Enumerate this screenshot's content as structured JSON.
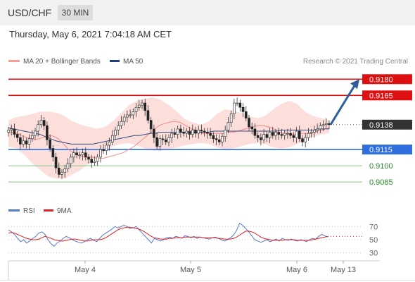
{
  "header": {
    "symbol": "USD/CHF",
    "timeframe": "30 MIN"
  },
  "datetime": "Thursday, May 6, 2021 7:04:18 AM CET",
  "legend": {
    "items": [
      {
        "label": "MA 20 + Bollinger Bands",
        "color": "#f4a09a"
      },
      {
        "label": "MA 50",
        "color": "#1f3f7a"
      }
    ],
    "credit": "Research © 2021 Trading Central"
  },
  "colors": {
    "resistance": "#dd1111",
    "current": "#333333",
    "pivot": "#2f6fdd",
    "support": "#8ac48a",
    "support_text": "#2a8a2a",
    "arrow": "#2f5f9a",
    "bollinger_fill": "#fbd8d5",
    "ma20": "#f08a82",
    "ma50": "#2d4a85",
    "rsi": "#5577cc",
    "rsi_ma": "#dd2222"
  },
  "chart_data": [
    {
      "type": "candlestick",
      "title": "USD/CHF",
      "x_tick_labels": [
        "May 4",
        "May 5",
        "May 6",
        "May 13"
      ],
      "ylim": [
        0.9076,
        0.9188
      ],
      "levels": [
        {
          "value": 0.918,
          "label": "0.9180",
          "kind": "resistance"
        },
        {
          "value": 0.9165,
          "label": "0.9165",
          "kind": "resistance"
        },
        {
          "value": 0.9138,
          "label": "0.9138",
          "kind": "current"
        },
        {
          "value": 0.9115,
          "label": "0.9115",
          "kind": "pivot"
        },
        {
          "value": 0.91,
          "label": "0.9100",
          "kind": "support"
        },
        {
          "value": 0.9085,
          "label": "0.9085",
          "kind": "support"
        }
      ],
      "forecast_arrow": {
        "from": 0.9138,
        "to": 0.918
      },
      "series_close": [
        0.9133,
        0.9134,
        0.9129,
        0.9126,
        0.912,
        0.9123,
        0.912,
        0.9125,
        0.9128,
        0.9132,
        0.9138,
        0.9142,
        0.9137,
        0.9124,
        0.9116,
        0.9108,
        0.9098,
        0.9092,
        0.9094,
        0.9097,
        0.9102,
        0.9108,
        0.9112,
        0.911,
        0.911,
        0.9112,
        0.9108,
        0.9106,
        0.9103,
        0.9104,
        0.9108,
        0.9115,
        0.9114,
        0.9119,
        0.9122,
        0.9128,
        0.9133,
        0.9137,
        0.9141,
        0.9145,
        0.9147,
        0.9147,
        0.915,
        0.9154,
        0.9156,
        0.9158,
        0.9151,
        0.9142,
        0.9134,
        0.9126,
        0.9118,
        0.9125,
        0.9124,
        0.9122,
        0.9126,
        0.913,
        0.9129,
        0.9134,
        0.9131,
        0.913,
        0.9132,
        0.9129,
        0.9133,
        0.913,
        0.9133,
        0.9132,
        0.9131,
        0.913,
        0.9128,
        0.9125,
        0.9124,
        0.9122,
        0.9127,
        0.9133,
        0.914,
        0.9148,
        0.9158,
        0.9158,
        0.9154,
        0.915,
        0.9144,
        0.9136,
        0.9134,
        0.9128,
        0.9126,
        0.9124,
        0.9129,
        0.9126,
        0.9131,
        0.9128,
        0.9131,
        0.9129,
        0.9128,
        0.913,
        0.913,
        0.9128,
        0.9126,
        0.9132,
        0.9125,
        0.9122,
        0.9126,
        0.913,
        0.9131,
        0.9133,
        0.9134,
        0.9137,
        0.9138,
        0.9139,
        0.9138
      ],
      "ma20": [
        0.913,
        0.9131,
        0.913,
        0.9129,
        0.9127,
        0.9126,
        0.9125,
        0.9124,
        0.9125,
        0.9126,
        0.9127,
        0.9128,
        0.9127,
        0.9125,
        0.9122,
        0.9118,
        0.9114,
        0.9112,
        0.911,
        0.9109,
        0.9108,
        0.9108,
        0.9108,
        0.9107,
        0.9107,
        0.9107,
        0.9108,
        0.9109,
        0.911,
        0.9111,
        0.9112,
        0.9114,
        0.9116,
        0.9118,
        0.9121,
        0.9124,
        0.9127,
        0.913,
        0.9133,
        0.9136,
        0.9138,
        0.9139,
        0.914,
        0.9141,
        0.9141,
        0.914,
        0.9138,
        0.9136,
        0.9134,
        0.9133,
        0.9131,
        0.913,
        0.913,
        0.913,
        0.913,
        0.913,
        0.913,
        0.913,
        0.9131,
        0.9131,
        0.9132,
        0.9133,
        0.9134,
        0.9135,
        0.9136,
        0.9137,
        0.9137,
        0.9137,
        0.9136,
        0.9135,
        0.9133,
        0.9131,
        0.913,
        0.9129,
        0.9129,
        0.9129,
        0.913,
        0.913,
        0.913,
        0.913,
        0.9131,
        0.9132,
        0.9133,
        0.9134,
        0.9135
      ],
      "ma50": [
        0.9135,
        0.9134,
        0.9133,
        0.9132,
        0.9131,
        0.913,
        0.9129,
        0.9127,
        0.9125,
        0.9123,
        0.9122,
        0.9121,
        0.912,
        0.912,
        0.912,
        0.912,
        0.912,
        0.9121,
        0.9122,
        0.9123,
        0.9124,
        0.9125,
        0.9126,
        0.9127,
        0.9128,
        0.9128,
        0.9129,
        0.913,
        0.913,
        0.9131,
        0.9131,
        0.9131,
        0.9131,
        0.9131,
        0.9131,
        0.9131,
        0.9131,
        0.9131,
        0.9131,
        0.9132,
        0.9132,
        0.9132,
        0.9132,
        0.9132,
        0.9132,
        0.9132,
        0.9132,
        0.9132,
        0.9132,
        0.9132,
        0.9132,
        0.9132,
        0.9133,
        0.9133,
        0.9133,
        0.9133,
        0.9133,
        0.9133,
        0.9133,
        0.9134,
        0.9134,
        0.9134
      ],
      "bollinger_upper": [
        0.9142,
        0.9145,
        0.9146,
        0.9148,
        0.915,
        0.915,
        0.9149,
        0.9146,
        0.9141,
        0.9138,
        0.9136,
        0.9134,
        0.9136,
        0.9141,
        0.9148,
        0.9156,
        0.916,
        0.9162,
        0.9163,
        0.9161,
        0.9156,
        0.915,
        0.9143,
        0.914,
        0.9138,
        0.9141,
        0.9148,
        0.9152,
        0.9151,
        0.9149,
        0.9146,
        0.9144,
        0.9146,
        0.9152,
        0.9157,
        0.916,
        0.9157,
        0.915,
        0.9146,
        0.9144,
        0.9142
      ],
      "bollinger_lower": [
        0.9118,
        0.9116,
        0.911,
        0.9102,
        0.9096,
        0.909,
        0.9088,
        0.9088,
        0.9092,
        0.9096,
        0.9102,
        0.9108,
        0.9114,
        0.9118,
        0.912,
        0.9121,
        0.9119,
        0.9116,
        0.9114,
        0.9114,
        0.9115,
        0.9117,
        0.9119,
        0.912,
        0.9121,
        0.912,
        0.9117,
        0.9115,
        0.9116,
        0.9118,
        0.912,
        0.9121,
        0.912,
        0.9117,
        0.9116,
        0.9117,
        0.912,
        0.9124,
        0.9127,
        0.9129,
        0.913
      ]
    },
    {
      "type": "line",
      "title": "RSI",
      "legend": [
        "RSI",
        "9MA"
      ],
      "yticks": [
        "70",
        "50",
        "30"
      ],
      "ylim": [
        20,
        80
      ],
      "series": [
        {
          "name": "RSI",
          "values": [
            65,
            62,
            58,
            52,
            47,
            50,
            45,
            48,
            52,
            55,
            60,
            62,
            58,
            50,
            44,
            40,
            45,
            48,
            52,
            55,
            53,
            50,
            48,
            46,
            45,
            47,
            50,
            52,
            49,
            47,
            52,
            57,
            60,
            63,
            66,
            70,
            68,
            70,
            72,
            70,
            67,
            68,
            70,
            65,
            60,
            55,
            50,
            45,
            52,
            50,
            48,
            50,
            53,
            54,
            52,
            55,
            54,
            52,
            56,
            55,
            53,
            55,
            52,
            54,
            53,
            52,
            51,
            53,
            54,
            52,
            50,
            48,
            50,
            53,
            57,
            64,
            75,
            72,
            67,
            62,
            56,
            50,
            48,
            46,
            48,
            50,
            47,
            49,
            51,
            48,
            52,
            50,
            49,
            51,
            49,
            48,
            50,
            49,
            47,
            50,
            52,
            51,
            55,
            58,
            56,
            54
          ]
        },
        {
          "name": "9MA",
          "values": [
            60,
            61,
            60,
            58,
            56,
            54,
            52,
            51,
            50,
            50,
            51,
            53,
            55,
            54,
            52,
            50,
            49,
            48,
            48,
            49,
            50,
            51,
            51,
            50,
            49,
            48,
            48,
            49,
            50,
            50,
            50,
            51,
            53,
            56,
            59,
            62,
            65,
            67,
            68,
            69,
            69,
            68,
            67,
            66,
            64,
            61,
            58,
            55,
            53,
            52,
            51,
            51,
            51,
            52,
            52,
            53,
            53,
            53,
            54,
            54,
            54,
            54,
            54,
            54,
            53,
            53,
            53,
            53,
            53,
            52,
            52,
            51,
            51,
            51,
            52,
            54,
            57,
            60,
            63,
            63,
            62,
            60,
            57,
            54,
            52,
            51,
            50,
            49,
            49,
            49,
            49,
            50,
            50,
            50,
            50,
            49,
            49,
            49,
            49,
            49,
            50,
            51,
            52,
            53,
            54,
            55
          ]
        }
      ]
    }
  ]
}
